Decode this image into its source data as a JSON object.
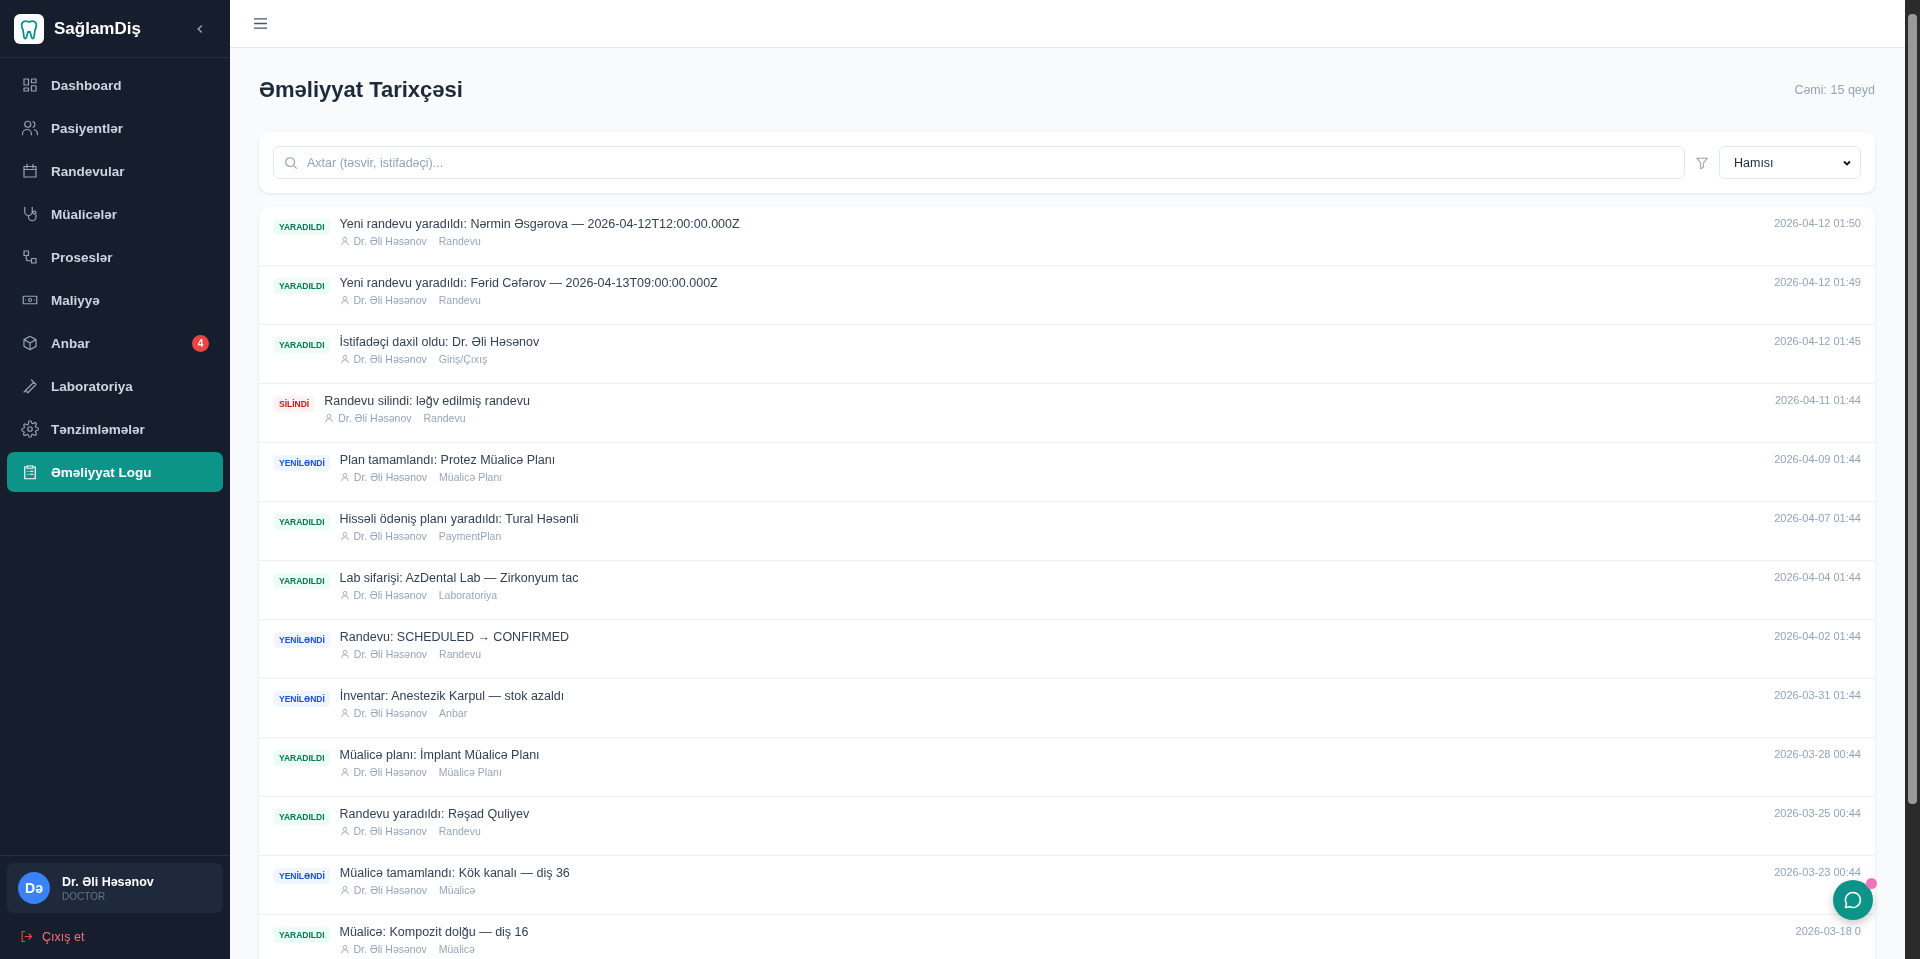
{
  "sidebar": {
    "brand": "SağlamDiş",
    "items": [
      {
        "label": "Dashboard",
        "selected": false
      },
      {
        "label": "Pasiyentlər",
        "selected": false
      },
      {
        "label": "Randevular",
        "selected": false
      },
      {
        "label": "Müalicələr",
        "selected": false
      },
      {
        "label": "Proseslər",
        "selected": false
      },
      {
        "label": "Maliyyə",
        "selected": false
      },
      {
        "label": "Anbar",
        "selected": false,
        "badge": "4"
      },
      {
        "label": "Laboratoriya",
        "selected": false
      },
      {
        "label": "Tənzimləmələr",
        "selected": false
      },
      {
        "label": "Əməliyyat Logu",
        "selected": true
      }
    ],
    "user": {
      "initials": "Də",
      "name": "Dr. Əli Həsənov",
      "role": "DOCTOR"
    },
    "logout": "Çıxış et"
  },
  "page": {
    "title": "Əməliyyat Tarixçəsi",
    "total": "Cəmi: 15 qeyd"
  },
  "search": {
    "placeholder": "Axtar (təsvir, istifadəçi)..."
  },
  "filter": {
    "value": "Hamısı"
  },
  "log": [
    {
      "kind": "created",
      "badge": "YARADILDI",
      "text": "Yeni randevu yaradıldı: Nərmin Əsgərova — 2026-04-12T12:00:00.000Z",
      "user": "Dr. Əli Həsənov",
      "module": "Randevu",
      "time": "2026-04-12 01:50"
    },
    {
      "kind": "created",
      "badge": "YARADILDI",
      "text": "Yeni randevu yaradıldı: Fərid Cəfərov — 2026-04-13T09:00:00.000Z",
      "user": "Dr. Əli Həsənov",
      "module": "Randevu",
      "time": "2026-04-12 01:49"
    },
    {
      "kind": "created",
      "badge": "YARADILDI",
      "text": "İstifadəçi daxil oldu: Dr. Əli Həsənov",
      "user": "Dr. Əli Həsənov",
      "module": "Giriş/Çıxış",
      "time": "2026-04-12 01:45"
    },
    {
      "kind": "deleted",
      "badge": "SİLİNDİ",
      "text": "Randevu silindi: ləğv edilmiş randevu",
      "user": "Dr. Əli Həsənov",
      "module": "Randevu",
      "time": "2026-04-11 01:44"
    },
    {
      "kind": "updated",
      "badge": "YENİLƏNDİ",
      "text": "Plan tamamlandı: Protez Müalicə Planı",
      "user": "Dr. Əli Həsənov",
      "module": "Müalicə Planı",
      "time": "2026-04-09 01:44"
    },
    {
      "kind": "created",
      "badge": "YARADILDI",
      "text": "Hissəli ödəniş planı yaradıldı: Tural Həsənli",
      "user": "Dr. Əli Həsənov",
      "module": "PaymentPlan",
      "time": "2026-04-07 01:44"
    },
    {
      "kind": "created",
      "badge": "YARADILDI",
      "text": "Lab sifarişi: AzDental Lab — Zirkonyum tac",
      "user": "Dr. Əli Həsənov",
      "module": "Laboratoriya",
      "time": "2026-04-04 01:44"
    },
    {
      "kind": "updated",
      "badge": "YENİLƏNDİ",
      "text": "Randevu: SCHEDULED → CONFIRMED",
      "user": "Dr. Əli Həsənov",
      "module": "Randevu",
      "time": "2026-04-02 01:44"
    },
    {
      "kind": "updated",
      "badge": "YENİLƏNDİ",
      "text": "İnventar: Anestezik Karpul — stok azaldı",
      "user": "Dr. Əli Həsənov",
      "module": "Anbar",
      "time": "2026-03-31 01:44"
    },
    {
      "kind": "created",
      "badge": "YARADILDI",
      "text": "Müalicə planı: İmplant Müalicə Planı",
      "user": "Dr. Əli Həsənov",
      "module": "Müalicə Planı",
      "time": "2026-03-28 00:44"
    },
    {
      "kind": "created",
      "badge": "YARADILDI",
      "text": "Randevu yaradıldı: Rəşad Quliyev",
      "user": "Dr. Əli Həsənov",
      "module": "Randevu",
      "time": "2026-03-25 00:44"
    },
    {
      "kind": "updated",
      "badge": "YENİLƏNDİ",
      "text": "Müalicə tamamlandı: Kök kanalı — diş 36",
      "user": "Dr. Əli Həsənov",
      "module": "Müalicə",
      "time": "2026-03-23 00:44"
    },
    {
      "kind": "created",
      "badge": "YARADILDI",
      "text": "Müalicə: Kompozit dolğu — diş 16",
      "user": "Dr. Əli Həsənov",
      "module": "Müalicə",
      "time": "2026-03-18 0"
    }
  ]
}
